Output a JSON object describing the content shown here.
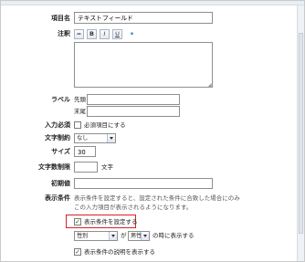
{
  "fields": {
    "item_name": {
      "label": "項目名",
      "value": "テキストフィールド"
    },
    "note": {
      "label": "注釈",
      "toolbar": {
        "rule_icon": "horizontal-rule-icon",
        "bold": "B",
        "italic": "I",
        "underline": "U",
        "link_icon": "link-icon"
      },
      "value": ""
    },
    "label": {
      "label": "ラベル",
      "prefix_label": "先頭",
      "suffix_label": "末尾",
      "prefix_value": "",
      "suffix_value": ""
    },
    "required": {
      "label": "入力必須",
      "checkbox_label": "必須項目にする",
      "checked": false
    },
    "char_limit": {
      "label": "文字制約",
      "selected": "なし"
    },
    "size": {
      "label": "サイズ",
      "value": "30"
    },
    "char_count_limit": {
      "label": "文字数制限",
      "value": "",
      "unit": "文字"
    },
    "initial_value": {
      "label": "初期値",
      "value": ""
    },
    "display_condition": {
      "label": "表示条件",
      "description_line1": "表示条件を設定すると、設定された条件に合致した場合にのみ",
      "description_line2": "この入力項目が表示されるようになります。",
      "set_checkbox_label": "表示条件を設定する",
      "set_checked": true,
      "condition_field": "性別",
      "condition_connector": "が",
      "condition_value": "男性",
      "condition_suffix": "の時に表示する",
      "show_desc_checkbox_label": "表示条件の説明を表示する",
      "show_desc_checked": true
    }
  },
  "colors": {
    "highlight": "#d81f26",
    "check": "#1a6d1a"
  }
}
